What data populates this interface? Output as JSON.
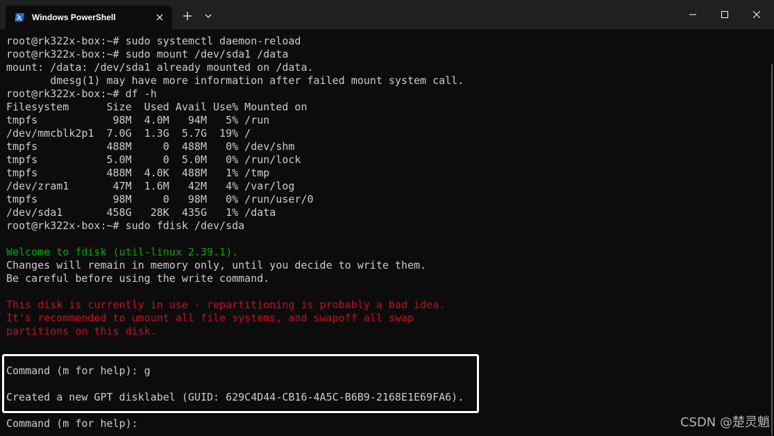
{
  "window": {
    "tab_title": "Windows PowerShell",
    "tab_icon": "powershell-icon",
    "new_tab_icon": "plus-icon",
    "dropdown_icon": "chevron-down-icon",
    "controls": [
      "minimize-icon",
      "maximize-icon",
      "close-icon"
    ],
    "accent_color": "#2671be"
  },
  "terminal": {
    "lines": [
      "root@rk322x-box:~# sudo systemctl daemon-reload",
      "root@rk322x-box:~# sudo mount /dev/sda1 /data",
      "mount: /data: /dev/sda1 already mounted on /data.",
      "       dmesg(1) may have more information after failed mount system call.",
      "root@rk322x-box:~# df -h",
      "Filesystem      Size  Used Avail Use% Mounted on",
      "tmpfs            98M  4.0M   94M   5% /run",
      "/dev/mmcblk2p1  7.0G  1.3G  5.7G  19% /",
      "tmpfs           488M     0  488M   0% /dev/shm",
      "tmpfs           5.0M     0  5.0M   0% /run/lock",
      "tmpfs           488M  4.0K  488M   1% /tmp",
      "/dev/zram1       47M  1.6M   42M   4% /var/log",
      "tmpfs            98M     0   98M   0% /run/user/0",
      "/dev/sda1       458G   28K  435G   1% /data",
      "root@rk322x-box:~# sudo fdisk /dev/sda",
      "",
      "Welcome to fdisk (util-linux 2.39.1).",
      "Changes will remain in memory only, until you decide to write them.",
      "Be careful before using the write command.",
      "",
      "This disk is currently in use - repartitioning is probably a bad idea.",
      "It's recommended to umount all file systems, and swapoff all swap",
      "partitions on this disk.",
      "",
      "Command (m for help): g",
      "",
      "Created a new GPT disklabel (GUID: 629C4D44-CB16-4A5C-B6B9-2168E1E69FA6).",
      "",
      "Command (m for help): "
    ],
    "green_color": "#13a10e",
    "red_color": "#c50f1f",
    "text_color": "#cccccc"
  },
  "watermark": "CSDN @楚灵魈"
}
